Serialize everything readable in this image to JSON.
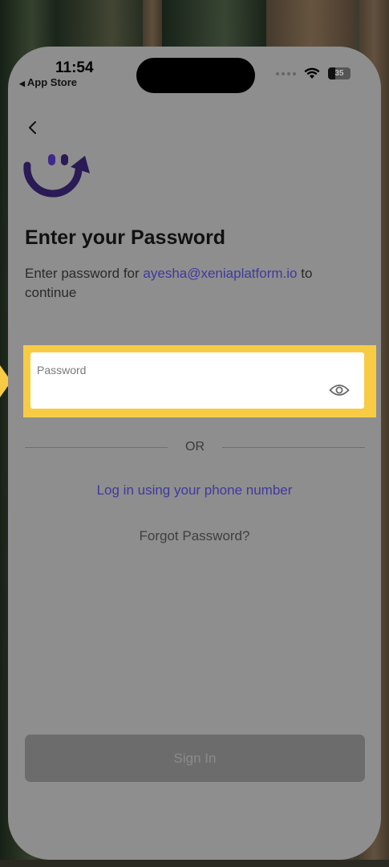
{
  "status_bar": {
    "time": "11:54",
    "back_app": "App Store",
    "back_arrow": "◀",
    "battery": "35",
    "icons": [
      "signal-dots-icon",
      "wifi-icon",
      "battery-icon"
    ]
  },
  "header": {
    "back_icon": "chevron-left-icon",
    "logo": "xenia-smile-logo"
  },
  "main": {
    "title": "Enter your Password",
    "subtitle_prefix": "Enter password for ",
    "email": "ayesha@xeniaplatform.io",
    "subtitle_suffix": " to continue",
    "password_field": {
      "label": "Password",
      "value": "",
      "toggle_icon": "eye-icon"
    },
    "divider_text": "OR",
    "phone_link": "Log in using your phone number",
    "forgot_link": "Forgot Password?",
    "signin_label": "Sign In"
  },
  "colors": {
    "accent": "#3d3a9e",
    "highlight": "#f7cc44",
    "overlay": "#8e8e8e",
    "logo": "#2a1a55"
  }
}
